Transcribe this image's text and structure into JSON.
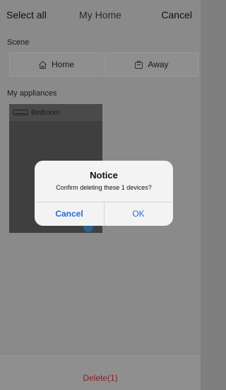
{
  "navbar": {
    "left_label": "Select all",
    "title": "My Home",
    "right_label": "Cancel"
  },
  "sections": {
    "scene_label": "Scene",
    "appliances_label": "My appliances"
  },
  "scenes": [
    {
      "label": "Home",
      "icon": "home-icon"
    },
    {
      "label": "Away",
      "icon": "luggage-icon"
    }
  ],
  "appliances": [
    {
      "name": "Bedroom",
      "icon": "device-icon",
      "selected": true
    }
  ],
  "bottom": {
    "delete_label": "Delete(1)"
  },
  "dialog": {
    "title": "Notice",
    "message": "Confirm deleting these 1 devices?",
    "cancel_label": "Cancel",
    "ok_label": "OK"
  },
  "colors": {
    "accent_blue": "#1e6fd0",
    "delete_red": "#c0392b"
  }
}
